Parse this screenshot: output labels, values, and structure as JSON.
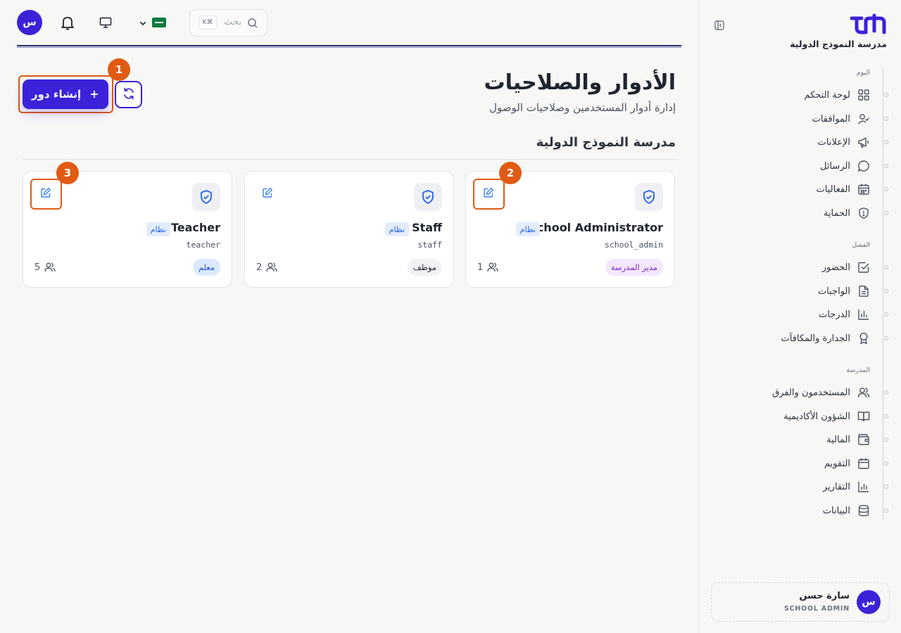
{
  "brand": {
    "name": "مدرسة النموذج الدولية",
    "accent": "#3b22d8"
  },
  "sidebar": {
    "sections": [
      {
        "title": "اليوم",
        "items": [
          {
            "label": "لوحة التحكم",
            "icon": "dashboard-icon"
          },
          {
            "label": "الموافقات",
            "icon": "user-check-icon"
          },
          {
            "label": "الإعلانات",
            "icon": "megaphone-icon"
          },
          {
            "label": "الرسائل",
            "icon": "message-icon"
          },
          {
            "label": "الفعاليات",
            "icon": "calendar-grid-icon"
          },
          {
            "label": "الحماية",
            "icon": "shield-alert-icon"
          }
        ]
      },
      {
        "title": "الفصل",
        "items": [
          {
            "label": "الحضور",
            "icon": "check-square-icon"
          },
          {
            "label": "الواجبات",
            "icon": "file-text-icon"
          },
          {
            "label": "الدرجات",
            "icon": "bar-chart-icon"
          },
          {
            "label": "الجدارة والمكافآت",
            "icon": "award-icon"
          }
        ]
      },
      {
        "title": "المدرسة",
        "items": [
          {
            "label": "المستخدمون والفرق",
            "icon": "users-icon"
          },
          {
            "label": "الشؤون الأكاديمية",
            "icon": "book-open-icon"
          },
          {
            "label": "المالية",
            "icon": "wallet-icon"
          },
          {
            "label": "التقويم",
            "icon": "calendar-icon"
          },
          {
            "label": "التقارير",
            "icon": "chart-icon"
          },
          {
            "label": "البيانات",
            "icon": "database-icon"
          }
        ]
      }
    ]
  },
  "user": {
    "name": "سارة حسن",
    "role": "SCHOOL ADMIN",
    "initial": "س"
  },
  "topbar": {
    "search_placeholder": "بحث",
    "shortcut": "K⌘",
    "avatar_initial": "س"
  },
  "page": {
    "title": "الأدوار والصلاحيات",
    "subtitle": "إدارة أدوار المستخدمين وصلاحيات الوصول",
    "create_label": "إنشاء دور",
    "school_title": "مدرسة النموذج الدولية"
  },
  "roles": [
    {
      "name": "School Administrator",
      "system_label": "نظام",
      "slug": "school_admin",
      "badge": "مدير المدرسة",
      "badge_bg": "#f3e8fd",
      "badge_fg": "#7e22ce",
      "count": "1"
    },
    {
      "name": "Staff",
      "system_label": "نظام",
      "slug": "staff",
      "badge": "موظف",
      "badge_bg": "#f1f2f4",
      "badge_fg": "#1f2430",
      "count": "2"
    },
    {
      "name": "Teacher",
      "system_label": "نظام",
      "slug": "teacher",
      "badge": "معلم",
      "badge_bg": "#dbe9fd",
      "badge_fg": "#1d4ed8",
      "count": "5"
    }
  ],
  "callouts": [
    "1",
    "2",
    "3"
  ],
  "highlight_color": "#e05a14"
}
